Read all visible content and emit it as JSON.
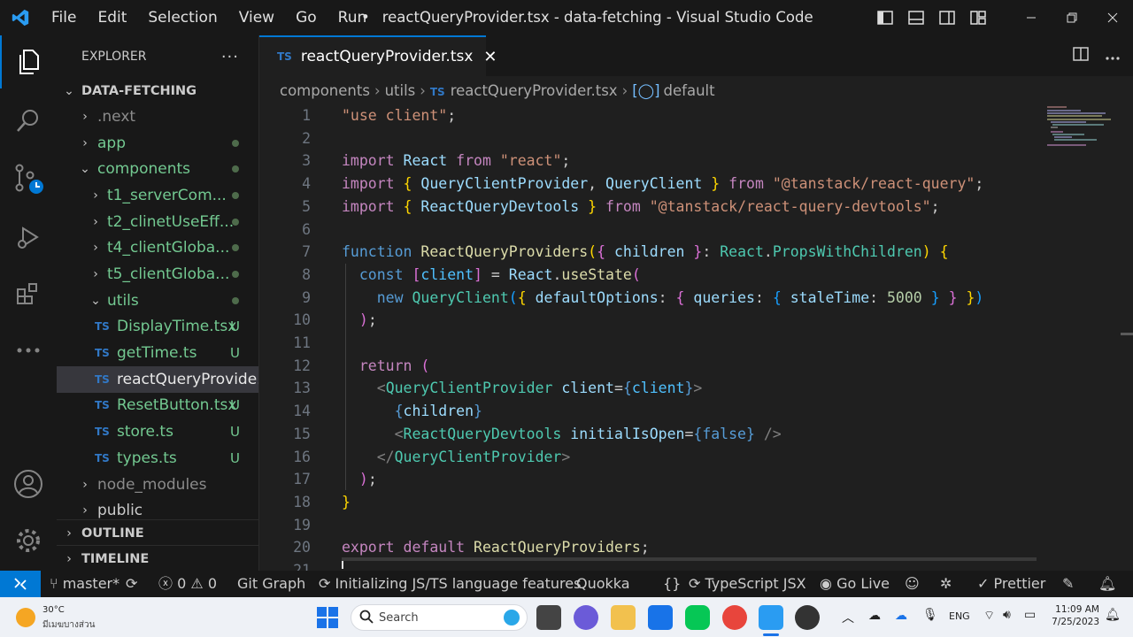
{
  "titlebar": {
    "menus": [
      "File",
      "Edit",
      "Selection",
      "View",
      "Go",
      "Run"
    ],
    "dot": "•",
    "title": "reactQueryProvider.tsx - data-fetching - Visual Studio Code"
  },
  "sidebar": {
    "header": "EXPLORER",
    "more": "···",
    "root": "DATA-FETCHING",
    "items": [
      {
        "label": ".next"
      },
      {
        "label": "app"
      },
      {
        "label": "components"
      },
      {
        "label": "t1_serverCom..."
      },
      {
        "label": "t2_clinetUseEff..."
      },
      {
        "label": "t4_clientGloba..."
      },
      {
        "label": "t5_clientGloba..."
      },
      {
        "label": "utils"
      },
      {
        "label": "DisplayTime.tsx",
        "status": "U"
      },
      {
        "label": "getTime.ts",
        "status": "U"
      },
      {
        "label": "reactQueryProvide..."
      },
      {
        "label": "ResetButton.tsx",
        "status": "U"
      },
      {
        "label": "store.ts",
        "status": "U"
      },
      {
        "label": "types.ts",
        "status": "U"
      },
      {
        "label": "node_modules"
      },
      {
        "label": "public"
      }
    ],
    "ts_badge": "TS",
    "outline": "OUTLINE",
    "timeline": "TIMELINE"
  },
  "editor": {
    "tab_label": "reactQueryProvider.tsx",
    "breadcrumbs": [
      "components",
      "utils",
      "reactQueryProvider.tsx",
      "default"
    ],
    "line_numbers": [
      "1",
      "2",
      "3",
      "4",
      "5",
      "6",
      "7",
      "8",
      "9",
      "10",
      "11",
      "12",
      "13",
      "14",
      "15",
      "16",
      "17",
      "18",
      "19",
      "20",
      "21"
    ]
  },
  "statusbar": {
    "branch": "master*",
    "errors": "0",
    "warnings": "0",
    "git_graph": "Git Graph",
    "js_ts": "Initializing JS/TS language features",
    "quokka": "Quokka",
    "braces": "{}",
    "language": "TypeScript JSX",
    "golive": "Go Live",
    "prettier": "Prettier"
  },
  "taskbar": {
    "weather_temp": "30°C",
    "weather_desc": "มีเมฆบางส่วน",
    "search": "Search",
    "lang": "ENG",
    "time": "11:09 AM",
    "date": "7/25/2023"
  },
  "colors": {
    "accent": "#0078d4",
    "keyword": "#c586c0",
    "string": "#ce9178",
    "function": "#dcdcaa",
    "variable": "#9cdcfe",
    "type": "#4ec9b0",
    "git_untracked": "#73c991"
  }
}
